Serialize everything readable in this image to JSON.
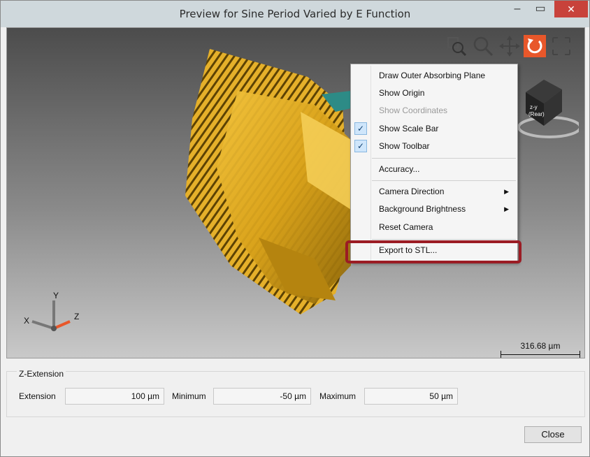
{
  "window": {
    "title": "Preview for Sine Period Varied by E Function"
  },
  "titlebar": {
    "min": "–",
    "max": "▭",
    "close": "✕"
  },
  "context_menu": {
    "items": [
      {
        "label": "Draw Outer Absorbing Plane",
        "checked": false,
        "disabled": false
      },
      {
        "label": "Show Origin",
        "checked": false,
        "disabled": false
      },
      {
        "label": "Show Coordinates",
        "checked": false,
        "disabled": true
      },
      {
        "label": "Show Scale Bar",
        "checked": true,
        "disabled": false
      },
      {
        "label": "Show Toolbar",
        "checked": true,
        "disabled": false
      },
      {
        "label": "Accuracy...",
        "checked": false,
        "disabled": false
      },
      {
        "label": "Camera Direction",
        "submenu": true
      },
      {
        "label": "Background Brightness",
        "submenu": true
      },
      {
        "label": "Reset Camera",
        "checked": false,
        "disabled": false
      },
      {
        "label": "Export to STL...",
        "checked": false,
        "disabled": false
      }
    ],
    "check_glyph": "✓",
    "submenu_glyph": "▶"
  },
  "nav_cube": {
    "face_label": "z-y\n(Rear)"
  },
  "scale_bar": {
    "label": "316.68 µm"
  },
  "axes": {
    "x": "X",
    "y": "Y",
    "z": "Z"
  },
  "z_extension": {
    "legend": "Z-Extension",
    "extension_label": "Extension",
    "extension_value": "100 µm",
    "minimum_label": "Minimum",
    "minimum_value": "-50 µm",
    "maximum_label": "Maximum",
    "maximum_value": "50 µm"
  },
  "buttons": {
    "close": "Close"
  },
  "colors": {
    "accent": "#e8572a",
    "highlight": "#9b1c24",
    "object": "#d9a21a"
  }
}
